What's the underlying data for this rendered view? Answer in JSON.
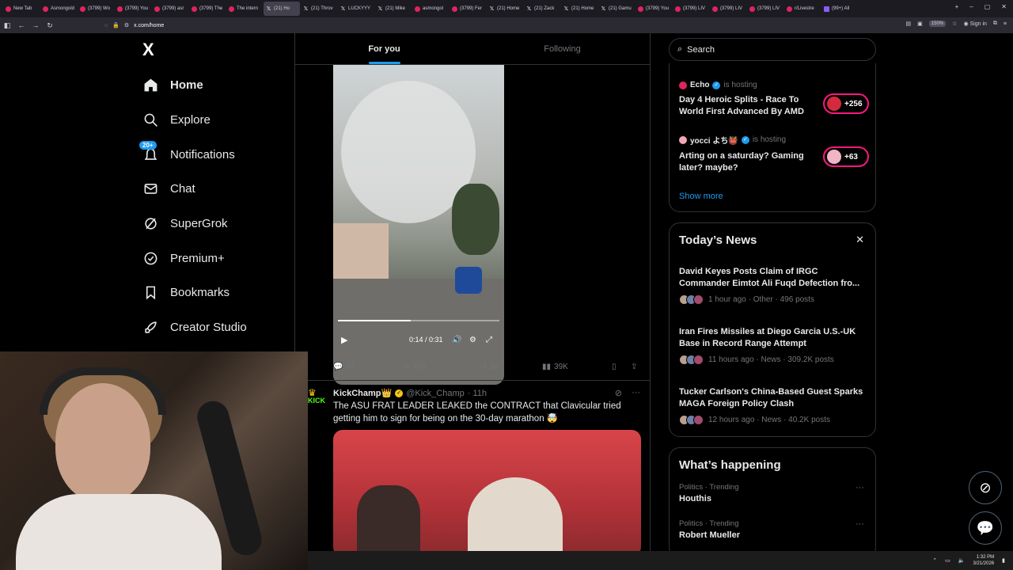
{
  "browser": {
    "tabs": [
      {
        "label": "New Tab",
        "icon": "firefox-icon"
      },
      {
        "label": "Asmongold",
        "icon": "youtube-icon"
      },
      {
        "label": "(3799) Wo",
        "icon": "youtube-icon"
      },
      {
        "label": "(3799) You",
        "icon": "youtube-icon"
      },
      {
        "label": "(3799) asr",
        "icon": "youtube-icon"
      },
      {
        "label": "(3799) The",
        "icon": "youtube-icon"
      },
      {
        "label": "The intern",
        "icon": "youtube-icon"
      },
      {
        "label": "(21) Ho",
        "icon": "x-icon",
        "active": true
      },
      {
        "label": "(21) Throv",
        "icon": "x-icon"
      },
      {
        "label": "LUCKYYY",
        "icon": "x-icon"
      },
      {
        "label": "(21) Mike",
        "icon": "x-icon"
      },
      {
        "label": "asmongol",
        "icon": "github-icon"
      },
      {
        "label": "(3799) Fer",
        "icon": "youtube-icon"
      },
      {
        "label": "(21) Home",
        "icon": "x-icon"
      },
      {
        "label": "(21) Zack",
        "icon": "x-icon"
      },
      {
        "label": "(21) Home",
        "icon": "x-icon"
      },
      {
        "label": "(21) Gamu",
        "icon": "x-icon"
      },
      {
        "label": "(3799) You",
        "icon": "youtube-icon"
      },
      {
        "label": "(3799) LIV",
        "icon": "youtube-icon"
      },
      {
        "label": "(3799) LIV",
        "icon": "youtube-icon"
      },
      {
        "label": "(3799) LIV",
        "icon": "youtube-icon"
      },
      {
        "label": "r/Livestre",
        "icon": "reddit-icon"
      },
      {
        "label": "(99+) All",
        "icon": "twitch-icon"
      }
    ],
    "url": "x.com/home",
    "zoom": "150%",
    "sign_in": "Sign in"
  },
  "nav": {
    "logo": "X",
    "items": [
      {
        "label": "Home",
        "icon": "home-icon"
      },
      {
        "label": "Explore",
        "icon": "search-icon"
      },
      {
        "label": "Notifications",
        "icon": "bell-icon",
        "badge": "20+"
      },
      {
        "label": "Chat",
        "icon": "mail-icon"
      },
      {
        "label": "SuperGrok",
        "icon": "grok-icon"
      },
      {
        "label": "Premium+",
        "icon": "verified-icon"
      },
      {
        "label": "Bookmarks",
        "icon": "bookmark-icon"
      },
      {
        "label": "Creator Studio",
        "icon": "rocket-icon"
      }
    ]
  },
  "timeline": {
    "tabs": [
      "For you",
      "Following"
    ],
    "video": {
      "time": "0:14 / 0:31",
      "progress": 0.45
    },
    "actions": {
      "replies": "37",
      "reposts": "406",
      "likes": "1.3K",
      "views": "39K"
    },
    "post2": {
      "avatar_text": "KICK",
      "name": "KickChamp👑",
      "handle": "@Kick_Champ",
      "time": "· 11h",
      "text": "The ASU FRAT LEADER LEAKED the CONTRACT that Clavicular tried getting him to sign for being on the 30-day marathon 🤯"
    }
  },
  "sidebar": {
    "search_placeholder": "Search",
    "live": [
      {
        "host": "Echo",
        "status": "is hosting",
        "title": "Day 4 Heroic Splits - Race To World First Advanced By AMD",
        "count": "+256"
      },
      {
        "host": "yocci よち👹",
        "status": "is hosting",
        "title": "Arting on a saturday? Gaming later? maybe?",
        "count": "+63"
      }
    ],
    "show_more": "Show more",
    "news": {
      "title": "Today’s News",
      "items": [
        {
          "title": "David Keyes Posts Claim of IRGC Commander Eimtot Ali Fuqd Defection fro...",
          "meta": "1 hour ago · Other · 496 posts"
        },
        {
          "title": "Iran Fires Missiles at Diego Garcia U.S.-UK Base in Record Range Attempt",
          "meta": "11 hours ago · News · 309.2K posts"
        },
        {
          "title": "Tucker Carlson's China-Based Guest Sparks MAGA Foreign Policy Clash",
          "meta": "12 hours ago · News · 40.2K posts"
        }
      ]
    },
    "happening": {
      "title": "What’s happening",
      "items": [
        {
          "category": "Politics · Trending",
          "topic": "Houthis"
        },
        {
          "category": "Politics · Trending",
          "topic": "Robert Mueller"
        }
      ]
    }
  },
  "taskbar": {
    "time": "1:32 PM",
    "date": "3/21/2026"
  }
}
